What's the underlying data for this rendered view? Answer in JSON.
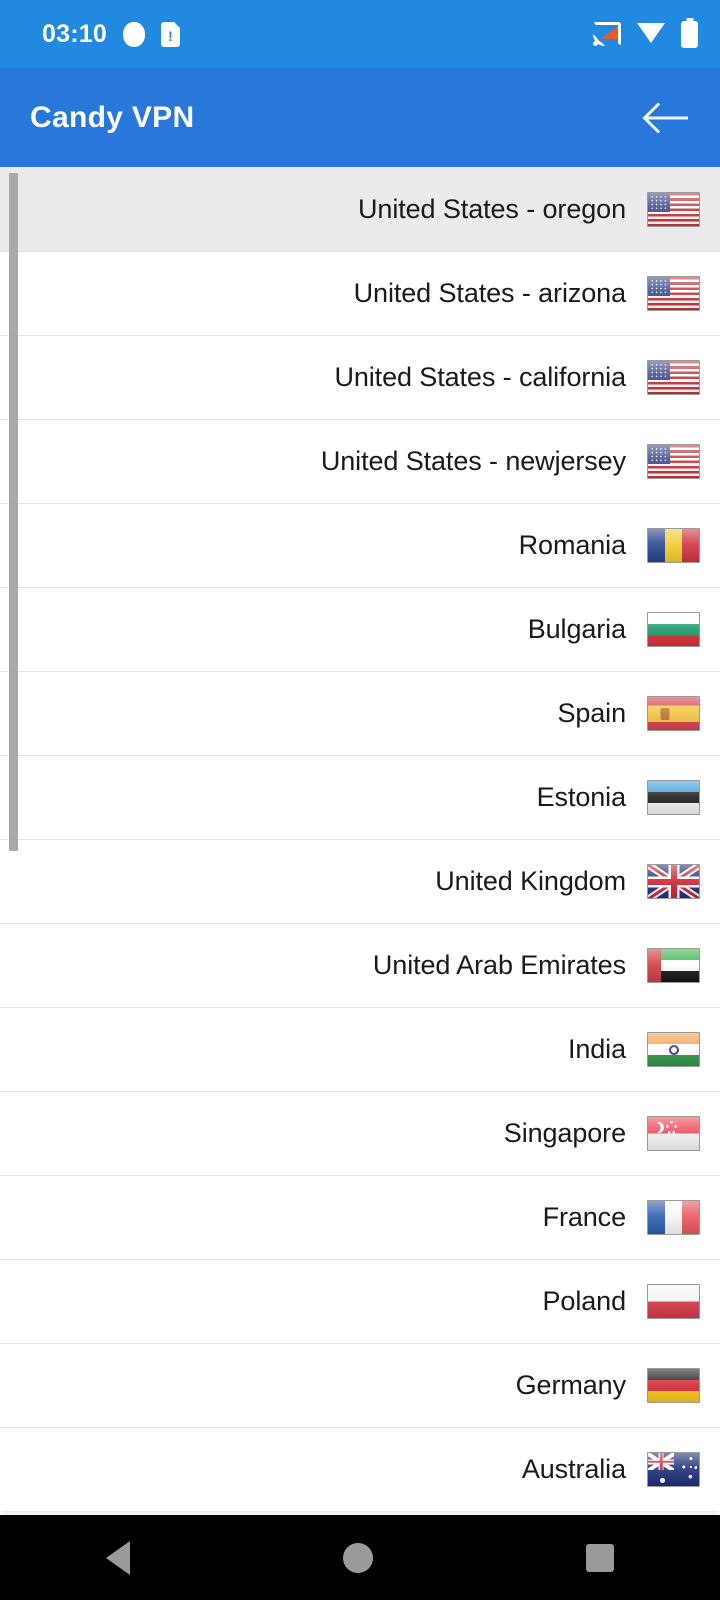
{
  "status_bar": {
    "time": "03:10",
    "icons_left": [
      "circle-icon",
      "sdcard-alert-icon"
    ],
    "icons_right": [
      "cast-icon",
      "wifi-icon",
      "battery-icon"
    ],
    "background_color": "#2289e0"
  },
  "app_bar": {
    "title": "Candy VPN",
    "back_icon": "back-arrow-icon",
    "background_color": "#2878dc",
    "text_color": "#ffffff"
  },
  "server_list": {
    "selected_index": 0,
    "selected_background": "#ebebeb",
    "scrollbar_visible": true,
    "items": [
      {
        "label": "United States - oregon",
        "flag": "us",
        "selected": true
      },
      {
        "label": "United States - arizona",
        "flag": "us",
        "selected": false
      },
      {
        "label": "United States - california",
        "flag": "us",
        "selected": false
      },
      {
        "label": "United States - newjersey",
        "flag": "us",
        "selected": false
      },
      {
        "label": "Romania",
        "flag": "ro",
        "selected": false
      },
      {
        "label": "Bulgaria",
        "flag": "bg",
        "selected": false
      },
      {
        "label": "Spain",
        "flag": "es",
        "selected": false
      },
      {
        "label": "Estonia",
        "flag": "ee",
        "selected": false
      },
      {
        "label": "United Kingdom",
        "flag": "gb",
        "selected": false
      },
      {
        "label": "United Arab Emirates",
        "flag": "ae",
        "selected": false
      },
      {
        "label": "India",
        "flag": "in",
        "selected": false
      },
      {
        "label": "Singapore",
        "flag": "sg",
        "selected": false
      },
      {
        "label": "France",
        "flag": "fr",
        "selected": false
      },
      {
        "label": "Poland",
        "flag": "pl",
        "selected": false
      },
      {
        "label": "Germany",
        "flag": "de",
        "selected": false
      },
      {
        "label": "Australia",
        "flag": "au",
        "selected": false
      }
    ]
  },
  "nav_bar": {
    "buttons": [
      "back-triangle-icon",
      "home-circle-icon",
      "recents-square-icon"
    ],
    "background_color": "#000000",
    "icon_color": "#9a9a9a"
  }
}
